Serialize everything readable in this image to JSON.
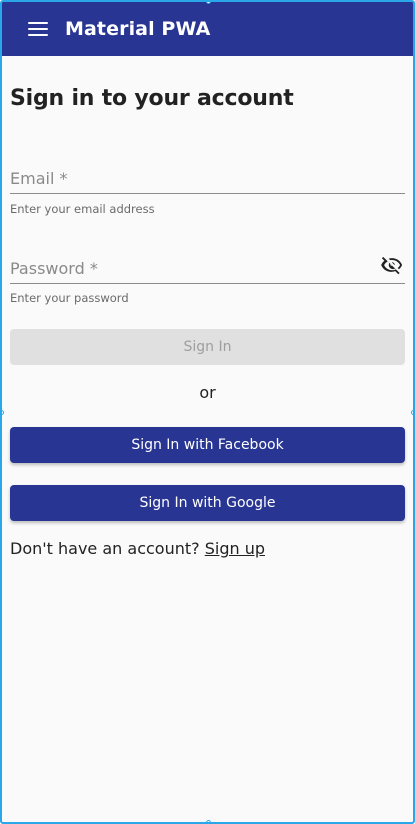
{
  "app": {
    "title": "Material PWA",
    "theme_color": "#283593",
    "frame_color": "#29a7e8",
    "menu_icon": "menu-icon"
  },
  "page": {
    "title": "Sign in to your account"
  },
  "form": {
    "email": {
      "label": "Email *",
      "value": "",
      "helper": "Enter your email address"
    },
    "password": {
      "label": "Password *",
      "value": "",
      "helper": "Enter your password",
      "visibility_icon": "visibility-off-icon"
    },
    "sign_in_label": "Sign In",
    "sign_in_disabled": true,
    "or_text": "or",
    "facebook_label": "Sign In with Facebook",
    "google_label": "Sign In with Google"
  },
  "footer": {
    "prompt": "Don't have an account?",
    "signup_label": "Sign up"
  }
}
